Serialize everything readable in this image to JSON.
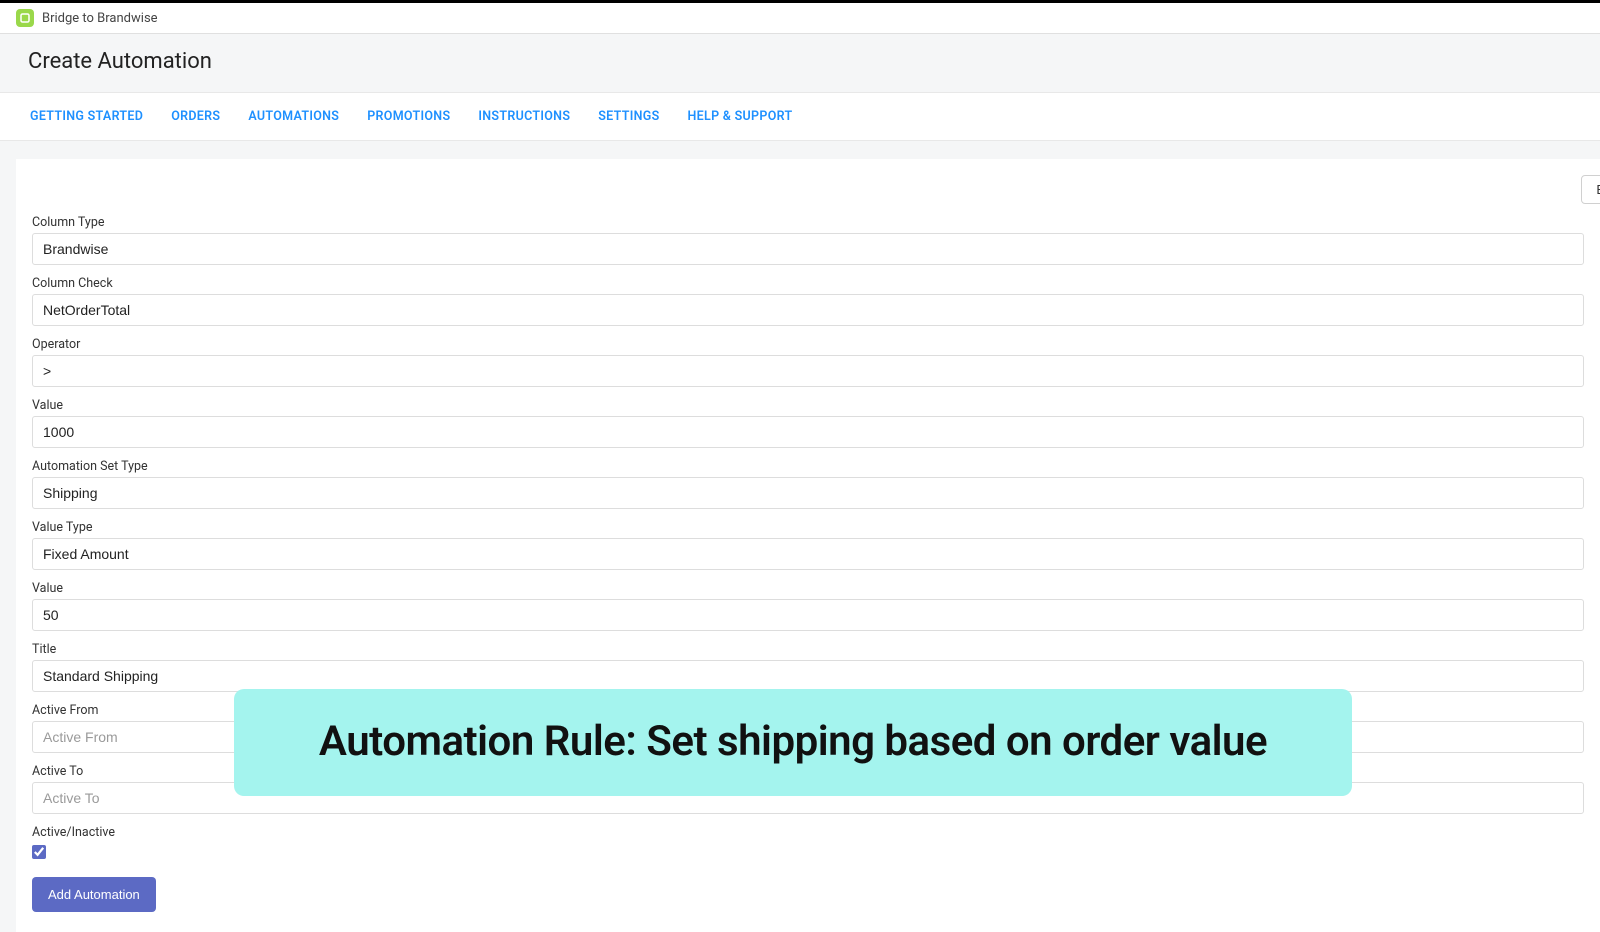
{
  "app": {
    "title": "Bridge to Brandwise"
  },
  "header": {
    "page_title": "Create Automation"
  },
  "nav": {
    "items": [
      "GETTING STARTED",
      "ORDERS",
      "AUTOMATIONS",
      "PROMOTIONS",
      "INSTRUCTIONS",
      "SETTINGS",
      "HELP & SUPPORT"
    ]
  },
  "topright_btn": "B",
  "form": {
    "column_type": {
      "label": "Column Type",
      "value": "Brandwise"
    },
    "column_check": {
      "label": "Column Check",
      "value": "NetOrderTotal"
    },
    "operator": {
      "label": "Operator",
      "value": ">"
    },
    "value1": {
      "label": "Value",
      "value": "1000"
    },
    "automation_set_type": {
      "label": "Automation Set Type",
      "value": "Shipping"
    },
    "value_type": {
      "label": "Value Type",
      "value": "Fixed Amount"
    },
    "value2": {
      "label": "Value",
      "value": "50"
    },
    "title": {
      "label": "Title",
      "value": "Standard Shipping"
    },
    "active_from": {
      "label": "Active From",
      "value": "",
      "placeholder": "Active From"
    },
    "active_to": {
      "label": "Active To",
      "value": "",
      "placeholder": "Active To"
    },
    "active_inactive": {
      "label": "Active/Inactive",
      "checked": true
    },
    "submit_label": "Add Automation"
  },
  "overlay": {
    "text": "Automation Rule: Set shipping based on order value"
  }
}
